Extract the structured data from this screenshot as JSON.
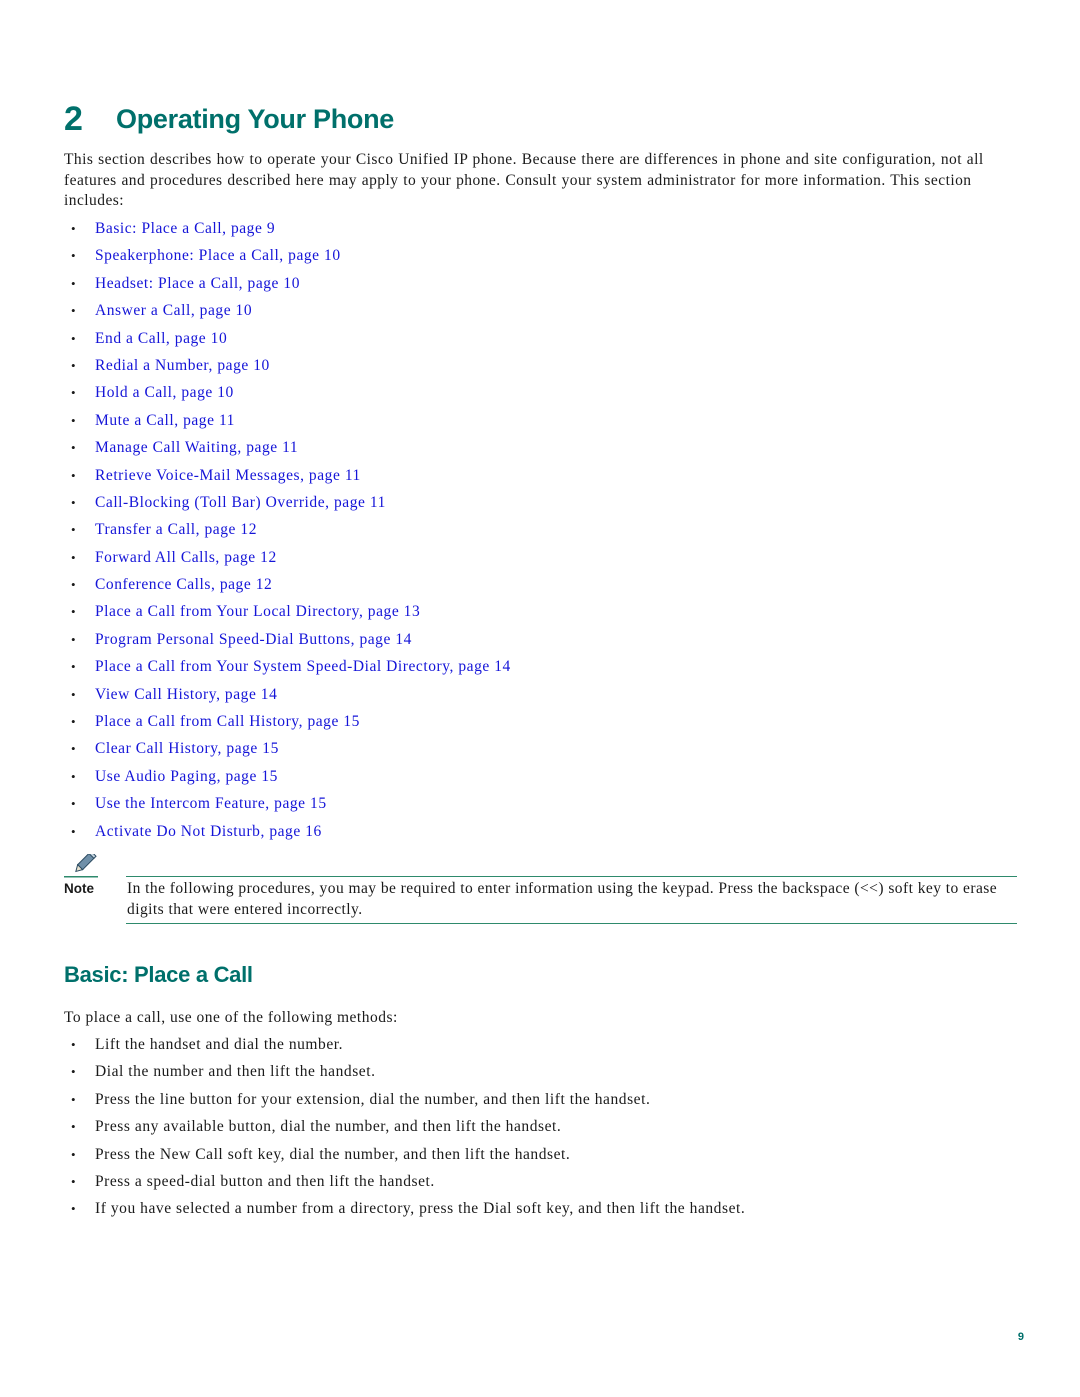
{
  "chapter": {
    "number": "2",
    "title": "Operating Your Phone"
  },
  "intro": "This section describes how to operate your Cisco Unified IP phone. Because there are differences in phone and site configuration, not all features and procedures described here may apply to your phone. Consult your system administrator for more information. This section includes:",
  "toc": [
    {
      "label": "Basic: Place a Call, page 9"
    },
    {
      "label": "Speakerphone: Place a Call, page 10"
    },
    {
      "label": "Headset: Place a Call, page 10"
    },
    {
      "label": "Answer a Call, page 10"
    },
    {
      "label": "End a Call, page 10"
    },
    {
      "label": "Redial a Number, page 10"
    },
    {
      "label": "Hold a Call, page 10"
    },
    {
      "label": "Mute a Call, page 11"
    },
    {
      "label": "Manage Call Waiting, page 11"
    },
    {
      "label": "Retrieve Voice-Mail Messages, page 11"
    },
    {
      "label": "Call-Blocking (Toll Bar) Override, page 11"
    },
    {
      "label": "Transfer a Call, page 12"
    },
    {
      "label": "Forward All Calls, page 12"
    },
    {
      "label": "Conference Calls, page 12"
    },
    {
      "label": "Place a Call from Your Local Directory, page 13"
    },
    {
      "label": "Program Personal Speed-Dial Buttons, page 14"
    },
    {
      "label": "Place a Call from Your System Speed-Dial Directory, page 14"
    },
    {
      "label": "View Call History, page 14"
    },
    {
      "label": "Place a Call from Call History, page 15"
    },
    {
      "label": "Clear Call History, page 15"
    },
    {
      "label": "Use Audio Paging, page 15"
    },
    {
      "label": "Use the Intercom Feature, page 15"
    },
    {
      "label": "Activate Do Not Disturb, page 16"
    }
  ],
  "bullet_char": "•",
  "note": {
    "icon": "pencil-icon",
    "label": "Note",
    "text": "In the following procedures, you may be required to enter information using the keypad. Press the backspace (<<) soft key to erase digits that were entered incorrectly."
  },
  "section": {
    "title": "Basic: Place a Call",
    "intro": "To place a call, use one of the following methods:",
    "methods": [
      {
        "text": "Lift the handset and dial the number."
      },
      {
        "text": "Dial the number and then lift the handset."
      },
      {
        "text": "Press the line button for your extension, dial the number, and then lift the handset."
      },
      {
        "text": "Press any available button, dial the number, and then lift the handset."
      },
      {
        "text": "Press the New Call soft key, dial the number, and then lift the handset."
      },
      {
        "text": "Press a speed-dial button and then lift the handset."
      },
      {
        "text": "If you have selected a number from a directory, press the Dial soft key, and then lift the handset."
      }
    ]
  },
  "page_number": "9",
  "colors": {
    "heading": "#00706b",
    "link": "#1515d8",
    "rule": "#2e8a6c",
    "text": "#1a1a1a"
  }
}
